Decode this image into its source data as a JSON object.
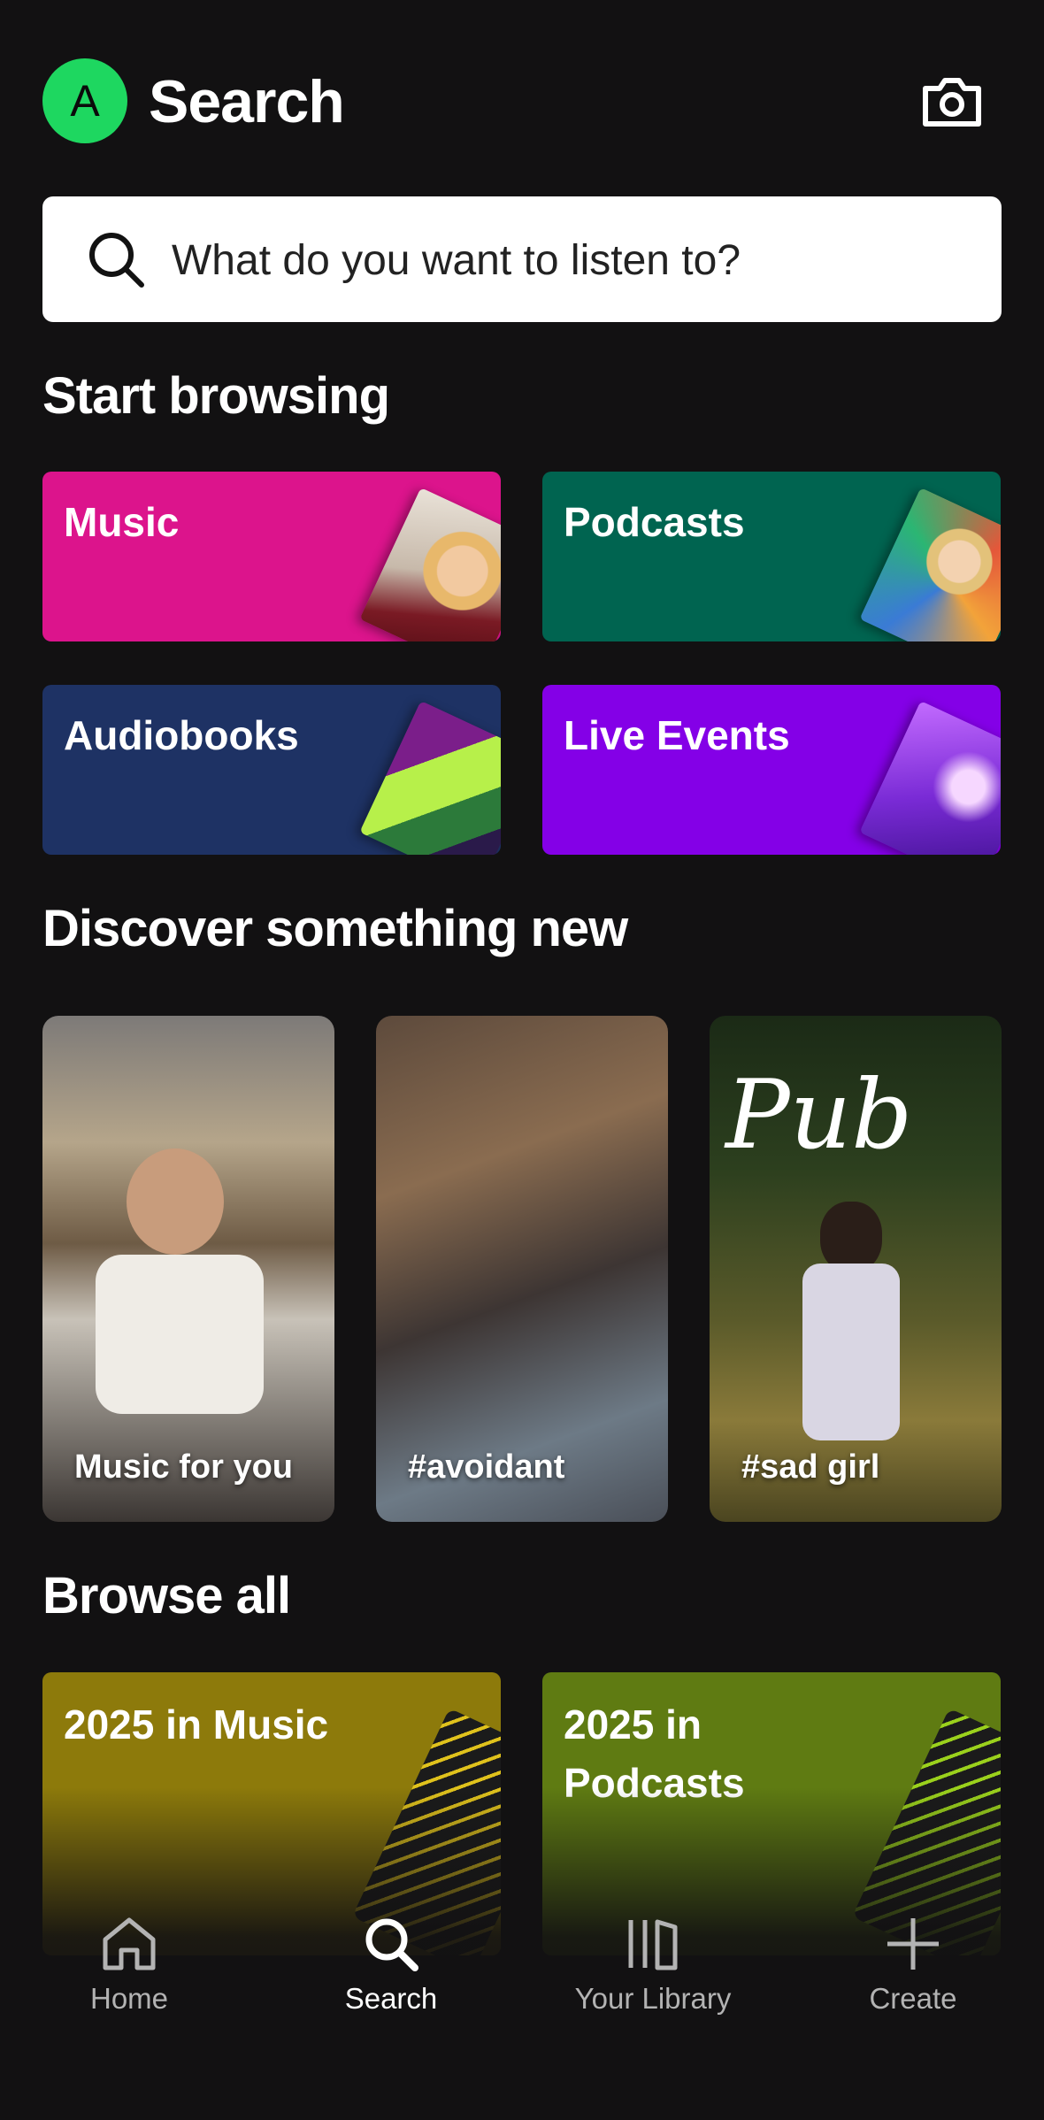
{
  "header": {
    "avatar_letter": "A",
    "title": "Search",
    "camera_icon": "camera-icon"
  },
  "search": {
    "placeholder": "What do you want to listen to?",
    "icon": "search-icon"
  },
  "start_browsing": {
    "title": "Start browsing",
    "tiles": [
      {
        "label": "Music",
        "color": "#dc148c"
      },
      {
        "label": "Podcasts",
        "color": "#006450"
      },
      {
        "label": "Audiobooks",
        "color": "#1e3264"
      },
      {
        "label": "Live Events",
        "color": "#8400e7"
      }
    ]
  },
  "discover": {
    "title": "Discover something new",
    "cards": [
      {
        "label": "Music for you"
      },
      {
        "label": "#avoidant"
      },
      {
        "label": "#sad girl",
        "overlay_text": "Pub"
      }
    ]
  },
  "browse_all": {
    "title": "Browse all",
    "tiles": [
      {
        "label": "2025 in Music",
        "color": "#8d7a0b"
      },
      {
        "label": "2025 in Podcasts",
        "color": "#5f7b12"
      }
    ]
  },
  "nav": {
    "items": [
      {
        "label": "Home",
        "icon": "home-icon"
      },
      {
        "label": "Search",
        "icon": "search-icon",
        "active": true
      },
      {
        "label": "Your Library",
        "icon": "library-icon"
      },
      {
        "label": "Create",
        "icon": "plus-icon"
      }
    ]
  }
}
